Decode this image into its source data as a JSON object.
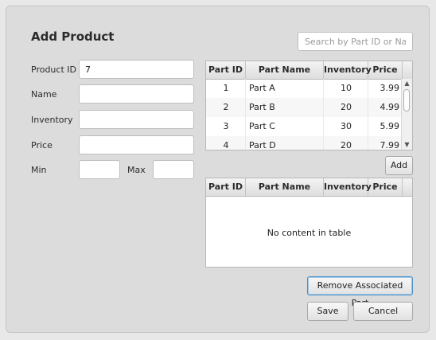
{
  "window": {
    "title": "Add Product"
  },
  "search": {
    "placeholder": "Search by Part ID or Name",
    "value": ""
  },
  "form": {
    "product_id": {
      "label": "Product ID",
      "value": "7"
    },
    "name": {
      "label": "Name",
      "value": ""
    },
    "inventory": {
      "label": "Inventory",
      "value": ""
    },
    "price": {
      "label": "Price",
      "value": ""
    },
    "min": {
      "label": "Min",
      "value": ""
    },
    "max": {
      "label": "Max",
      "value": ""
    }
  },
  "parts_table": {
    "columns": [
      "Part ID",
      "Part Name",
      "Inventory",
      "Price"
    ],
    "rows": [
      {
        "id": "1",
        "name": "Part A",
        "inventory": "10",
        "price": "3.99"
      },
      {
        "id": "2",
        "name": "Part B",
        "inventory": "20",
        "price": "4.99"
      },
      {
        "id": "3",
        "name": "Part C",
        "inventory": "30",
        "price": "5.99"
      },
      {
        "id": "4",
        "name": "Part D",
        "inventory": "20",
        "price": "7.99"
      }
    ]
  },
  "associated_table": {
    "columns": [
      "Part ID",
      "Part Name",
      "Inventory",
      "Price"
    ],
    "empty_text": "No content in table"
  },
  "buttons": {
    "add": "Add",
    "remove": "Remove Associated Part",
    "save": "Save",
    "cancel": "Cancel"
  }
}
